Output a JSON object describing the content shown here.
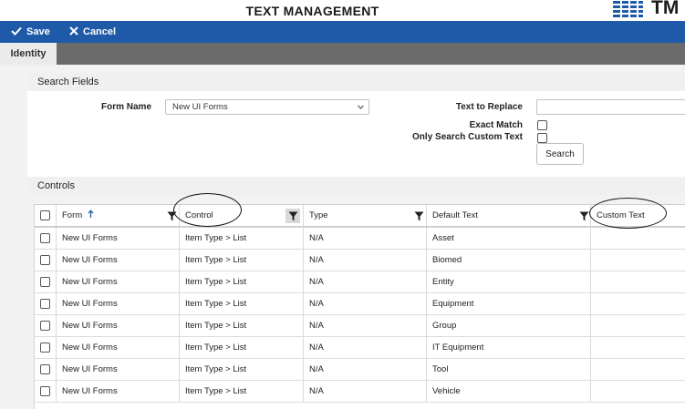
{
  "window": {
    "title": "TEXT MANAGEMENT",
    "logo_text": "TM"
  },
  "toolbar": {
    "save_label": "Save",
    "cancel_label": "Cancel"
  },
  "tabs": [
    {
      "label": "Identity",
      "active": true
    }
  ],
  "search_fields": {
    "section_title": "Search Fields",
    "form_name_label": "Form Name",
    "form_name_value": "New UI Forms",
    "text_to_replace_label": "Text to Replace",
    "text_to_replace_value": "",
    "exact_match_label": "Exact Match",
    "exact_match_checked": false,
    "only_custom_label": "Only Search Custom Text",
    "only_custom_checked": false,
    "search_button_label": "Search"
  },
  "controls": {
    "section_title": "Controls",
    "columns": [
      "Form",
      "Control",
      "Type",
      "Default Text",
      "Custom Text"
    ],
    "sort_column": "Form",
    "sort_direction": "ascending",
    "rows": [
      {
        "form": "New UI Forms",
        "control": "Item Type > List",
        "type": "N/A",
        "default_text": "Asset",
        "custom_text": ""
      },
      {
        "form": "New UI Forms",
        "control": "Item Type > List",
        "type": "N/A",
        "default_text": "Biomed",
        "custom_text": ""
      },
      {
        "form": "New UI Forms",
        "control": "Item Type > List",
        "type": "N/A",
        "default_text": "Entity",
        "custom_text": ""
      },
      {
        "form": "New UI Forms",
        "control": "Item Type > List",
        "type": "N/A",
        "default_text": "Equipment",
        "custom_text": ""
      },
      {
        "form": "New UI Forms",
        "control": "Item Type > List",
        "type": "N/A",
        "default_text": "Group",
        "custom_text": ""
      },
      {
        "form": "New UI Forms",
        "control": "Item Type > List",
        "type": "N/A",
        "default_text": "IT Equipment",
        "custom_text": ""
      },
      {
        "form": "New UI Forms",
        "control": "Item Type > List",
        "type": "N/A",
        "default_text": "Tool",
        "custom_text": ""
      },
      {
        "form": "New UI Forms",
        "control": "Item Type > List",
        "type": "N/A",
        "default_text": "Vehicle",
        "custom_text": ""
      }
    ]
  },
  "colors": {
    "toolbar": "#1e5aa8",
    "tabbar": "#6b6b6b",
    "accent": "#1e5aa8",
    "annotation": "#111111"
  },
  "icons": {
    "save": "checkmark-icon",
    "cancel": "x-icon",
    "sort": "arrow-up-icon",
    "filter": "funnel-icon",
    "dropdown": "chevron-down-icon"
  }
}
